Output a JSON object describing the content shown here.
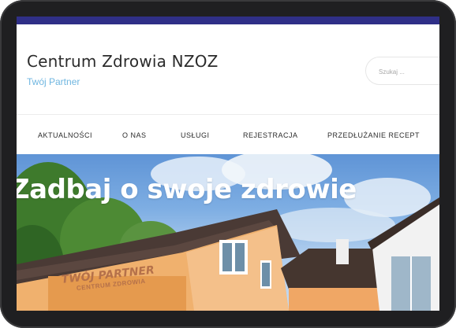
{
  "header": {
    "site_title": "Centrum Zdrowia NZOZ",
    "tagline": "Twój Partner",
    "search_placeholder": "Szukaj ..."
  },
  "nav": {
    "items": [
      {
        "label": "AKTUALNOŚCI"
      },
      {
        "label": "O NAS"
      },
      {
        "label": "USŁUGI"
      },
      {
        "label": "REJESTRACJA"
      },
      {
        "label": "PRZEDŁUŻANIE RECEPT"
      }
    ]
  },
  "hero": {
    "heading": "Zadbaj o swoje zdrowie",
    "sign_line1": "TWÓJ PARTNER",
    "sign_line2": "CENTRUM ZDROWIA"
  },
  "colors": {
    "topbar": "#2f2f87",
    "tagline": "#6fb6e0",
    "building_wall": "#f0b16e",
    "roof": "#4a3a35"
  }
}
